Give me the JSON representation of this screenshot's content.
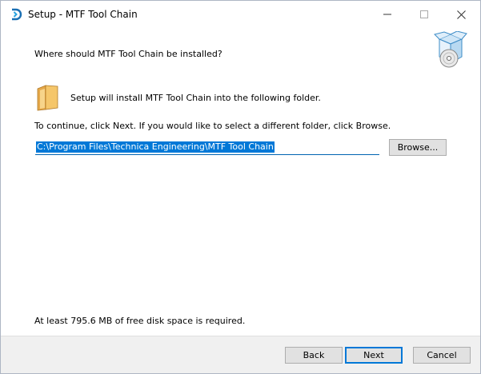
{
  "window": {
    "title": "Setup - MTF Tool Chain",
    "app_icon": "setup-app-icon"
  },
  "controls": {
    "minimize_icon": "minimize-icon",
    "maximize_icon": "maximize-icon",
    "close_icon": "close-icon"
  },
  "header": {
    "question": "Where should MTF Tool Chain be installed?",
    "icon": "setup-box-icon"
  },
  "body": {
    "folder_icon": "folder-icon",
    "info": "Setup will install MTF Tool Chain into the following folder.",
    "instruction": "To continue, click Next. If you would like to select a different folder, click Browse.",
    "path_value": "C:\\Program Files\\Technica Engineering\\MTF Tool Chain",
    "browse_label": "Browse...",
    "disk_space": "At least 795.6 MB of free disk space is required."
  },
  "footer": {
    "back_label": "Back",
    "next_label": "Next",
    "cancel_label": "Cancel"
  },
  "colors": {
    "accent": "#0078d7",
    "footer_bg": "#f0f0f0",
    "button_bg": "#e1e1e1",
    "folder": "#f5c66a"
  }
}
